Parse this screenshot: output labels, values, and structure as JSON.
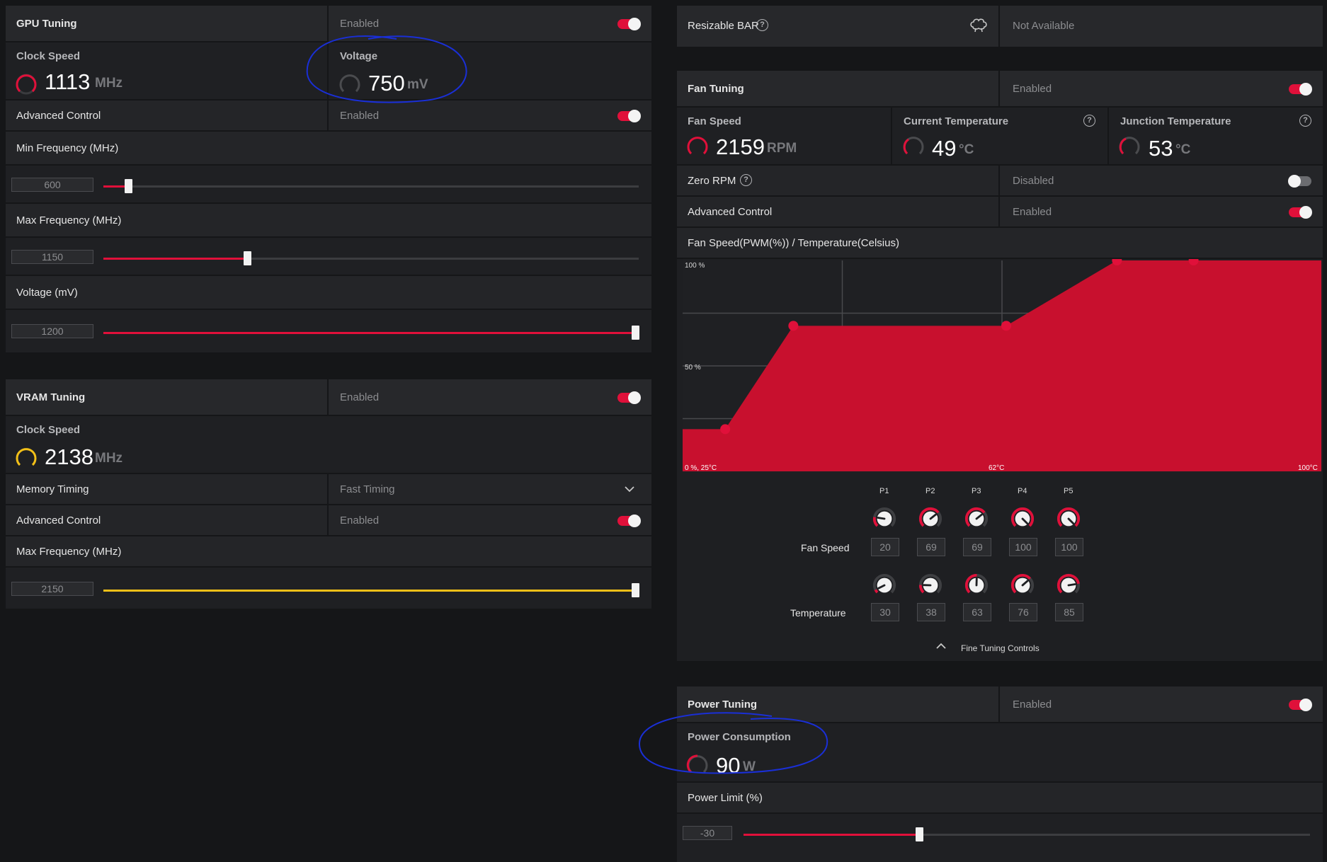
{
  "gpu_tuning": {
    "title": "GPU Tuning",
    "status": "Enabled",
    "clock_speed": {
      "label": "Clock Speed",
      "value": "1113",
      "unit": "MHz"
    },
    "voltage": {
      "label": "Voltage",
      "value": "750",
      "unit": "mV"
    },
    "advanced_control": {
      "label": "Advanced Control",
      "status": "Enabled"
    },
    "min_frequency": {
      "label": "Min Frequency (MHz)",
      "value": "600",
      "fraction": 0.045
    },
    "max_frequency": {
      "label": "Max Frequency (MHz)",
      "value": "1150",
      "fraction": 0.27
    },
    "voltage_mv": {
      "label": "Voltage (mV)",
      "value": "1200",
      "fraction": 1.0
    }
  },
  "vram_tuning": {
    "title": "VRAM Tuning",
    "status": "Enabled",
    "clock_speed": {
      "label": "Clock Speed",
      "value": "2138",
      "unit": "MHz"
    },
    "memory_timing": {
      "label": "Memory Timing",
      "value": "Fast Timing"
    },
    "advanced_control": {
      "label": "Advanced Control",
      "status": "Enabled"
    },
    "max_frequency": {
      "label": "Max Frequency (MHz)",
      "value": "2150",
      "fraction": 1.0
    }
  },
  "resizable_bar": {
    "label": "Resizable BAR",
    "status": "Not Available",
    "icon": "brain-icon"
  },
  "fan_tuning": {
    "title": "Fan Tuning",
    "status": "Enabled",
    "fan_speed": {
      "label": "Fan Speed",
      "value": "2159",
      "unit": "RPM"
    },
    "current_temperature": {
      "label": "Current Temperature",
      "value": "49",
      "unit": "°C"
    },
    "junction_temperature": {
      "label": "Junction Temperature",
      "value": "53",
      "unit": "°C"
    },
    "zero_rpm": {
      "label": "Zero RPM",
      "status": "Disabled"
    },
    "advanced_control": {
      "label": "Advanced Control",
      "status": "Enabled"
    },
    "curve_title": "Fan Speed(PWM(%)) / Temperature(Celsius)",
    "fine_tuning_label": "Fine Tuning Controls",
    "row_fan_speed": "Fan Speed",
    "row_temperature": "Temperature",
    "points": [
      {
        "label": "P1",
        "speed": "20",
        "temp": "30"
      },
      {
        "label": "P2",
        "speed": "69",
        "temp": "38"
      },
      {
        "label": "P3",
        "speed": "69",
        "temp": "63"
      },
      {
        "label": "P4",
        "speed": "100",
        "temp": "76"
      },
      {
        "label": "P5",
        "speed": "100",
        "temp": "85"
      }
    ]
  },
  "chart_data": {
    "type": "area",
    "title": "Fan Speed(PWM(%)) / Temperature(Celsius)",
    "x": [
      30,
      38,
      63,
      76,
      85
    ],
    "y": [
      20,
      69,
      69,
      100,
      100
    ],
    "xlim": [
      25,
      100
    ],
    "ylim": [
      0,
      100
    ],
    "tick_labels": {
      "y100": "100 %",
      "y50": "50 %",
      "origin": "0 %, 25°C",
      "xmid": "62°C",
      "xmax": "100°C"
    },
    "grid": true,
    "color": "#c8102e"
  },
  "power_tuning": {
    "title": "Power Tuning",
    "status": "Enabled",
    "power_consumption": {
      "label": "Power Consumption",
      "value": "90",
      "unit": "W"
    },
    "power_limit": {
      "label": "Power Limit (%)",
      "value": "-30",
      "fraction": 0.3
    }
  },
  "colors": {
    "accent": "#e0103a",
    "vram_accent": "#f2c018",
    "annotation": "#1a2fd6"
  }
}
